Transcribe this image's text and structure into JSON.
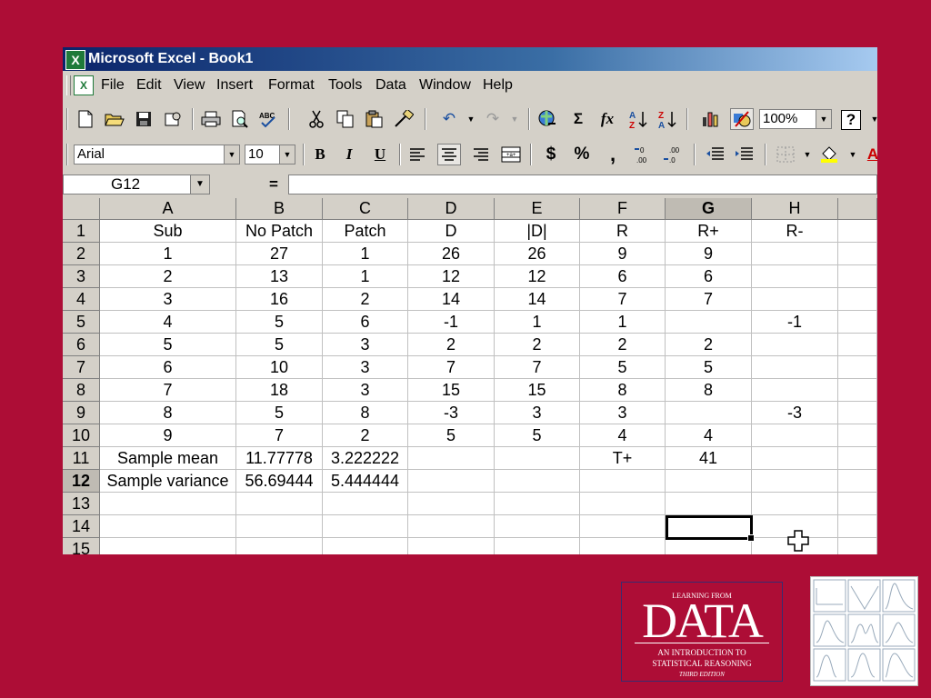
{
  "window": {
    "title": "Microsoft Excel - Book1"
  },
  "menu": [
    "File",
    "Edit",
    "View",
    "Insert",
    "Format",
    "Tools",
    "Data",
    "Window",
    "Help"
  ],
  "toolbar": {
    "zoom": "100%",
    "font_name": "Arial",
    "font_size": "10",
    "buttons": [
      "new-icon",
      "open-icon",
      "save-icon",
      "permission-icon",
      "print-icon",
      "print-preview-icon",
      "spelling-icon",
      "cut-icon",
      "copy-icon",
      "paste-icon",
      "format-painter-icon",
      "undo-icon",
      "redo-icon",
      "insert-hyperlink-icon",
      "autosum-icon",
      "paste-function-icon",
      "sort-ascending-icon",
      "sort-descending-icon",
      "chart-wizard-icon",
      "drawing-icon",
      "help-icon"
    ],
    "format_buttons": {
      "bold": "B",
      "italic": "I",
      "underline": "U",
      "currency": "$",
      "percent": "%",
      "comma": ","
    }
  },
  "formula_bar": {
    "name_box": "G12",
    "equals": "=",
    "value": ""
  },
  "sheet": {
    "columns": [
      "A",
      "B",
      "C",
      "D",
      "E",
      "F",
      "G",
      "H"
    ],
    "selected_column": "G",
    "selected_row": "12",
    "rows": [
      {
        "n": "1",
        "cells": [
          "Sub",
          "No Patch",
          "Patch",
          "D",
          "|D|",
          "R",
          "R+",
          "R-"
        ]
      },
      {
        "n": "2",
        "cells": [
          "1",
          "27",
          "1",
          "26",
          "26",
          "9",
          "9",
          ""
        ]
      },
      {
        "n": "3",
        "cells": [
          "2",
          "13",
          "1",
          "12",
          "12",
          "6",
          "6",
          ""
        ]
      },
      {
        "n": "4",
        "cells": [
          "3",
          "16",
          "2",
          "14",
          "14",
          "7",
          "7",
          ""
        ]
      },
      {
        "n": "5",
        "cells": [
          "4",
          "5",
          "6",
          "-1",
          "1",
          "1",
          "",
          "-1"
        ]
      },
      {
        "n": "6",
        "cells": [
          "5",
          "5",
          "3",
          "2",
          "2",
          "2",
          "2",
          ""
        ]
      },
      {
        "n": "7",
        "cells": [
          "6",
          "10",
          "3",
          "7",
          "7",
          "5",
          "5",
          ""
        ]
      },
      {
        "n": "8",
        "cells": [
          "7",
          "18",
          "3",
          "15",
          "15",
          "8",
          "8",
          ""
        ]
      },
      {
        "n": "9",
        "cells": [
          "8",
          "5",
          "8",
          "-3",
          "3",
          "3",
          "",
          "-3"
        ]
      },
      {
        "n": "10",
        "cells": [
          "9",
          "7",
          "2",
          "5",
          "5",
          "4",
          "4",
          ""
        ]
      },
      {
        "n": "11",
        "cells": [
          "Sample mean",
          "11.77778",
          "3.222222",
          "",
          "",
          "T+",
          "41",
          ""
        ]
      },
      {
        "n": "12",
        "cells": [
          "Sample variance",
          "56.69444",
          "5.444444",
          "",
          "",
          "",
          "",
          ""
        ]
      },
      {
        "n": "13",
        "cells": [
          "",
          "",
          "",
          "",
          "",
          "",
          "",
          ""
        ]
      },
      {
        "n": "14",
        "cells": [
          "",
          "",
          "",
          "",
          "",
          "",
          "",
          ""
        ]
      },
      {
        "n": "15",
        "cells": [
          "",
          "",
          "",
          "",
          "",
          "",
          "",
          ""
        ]
      }
    ]
  },
  "book_cover": {
    "kicker": "LEARNING FROM",
    "word": "DATA",
    "subtitle_1": "AN INTRODUCTION TO",
    "subtitle_2": "STATISTICAL REASONING",
    "edition": "THIRD EDITION",
    "background": "#ad0d36"
  },
  "colors": {
    "slide_background": "#ad0d36",
    "titlebar": "#0a246a",
    "chrome": "#d4d0c8"
  }
}
